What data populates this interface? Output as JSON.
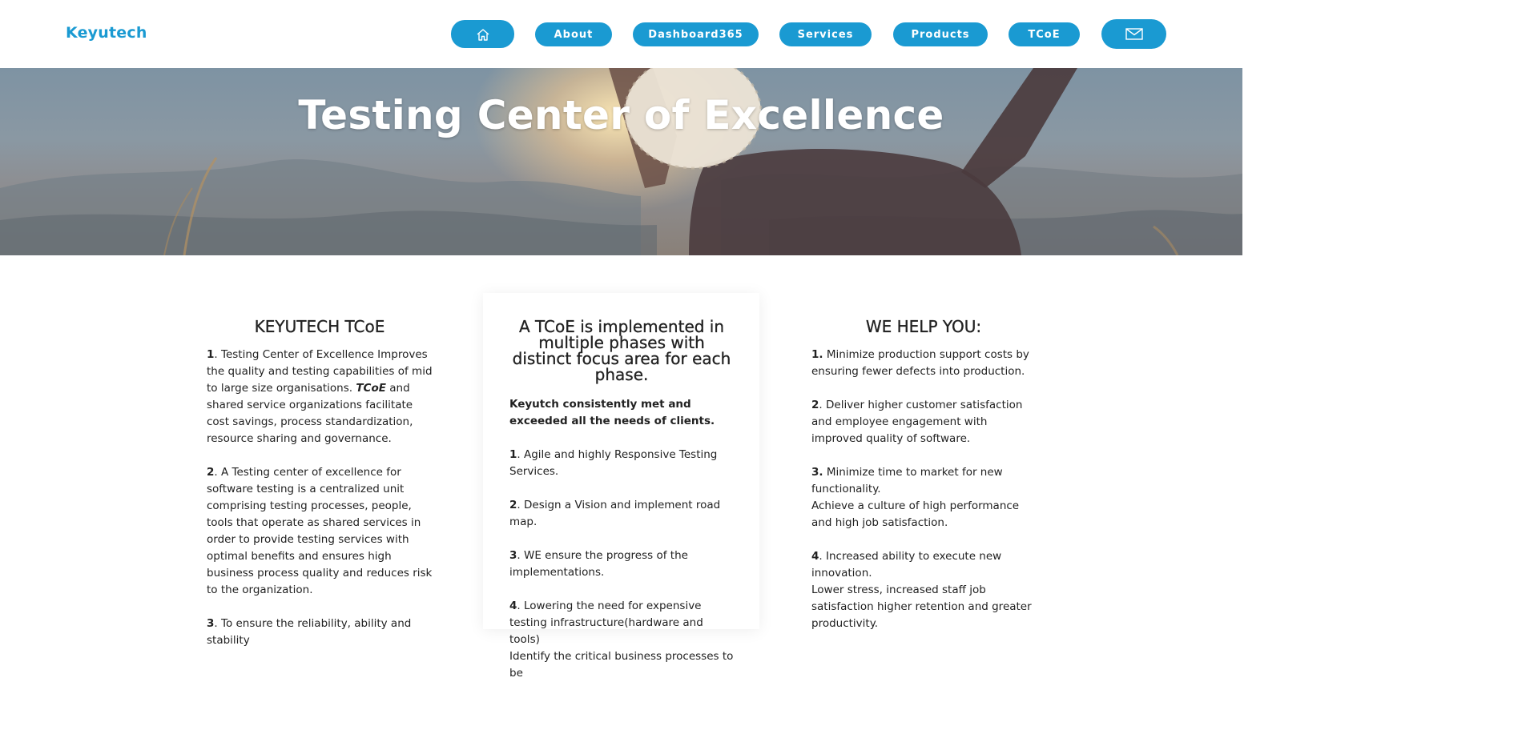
{
  "brand": "Keyutech",
  "nav": {
    "home_icon": "home-icon",
    "about": "About",
    "dashboard": "Dashboard365",
    "services": "Services",
    "products": "Products",
    "tcoe": "TCoE",
    "mail_icon": "mail-icon",
    "button_color": "#1a9ad2"
  },
  "hero": {
    "title": "Testing Center of Excellence"
  },
  "left": {
    "heading": "KEYUTECH TCoE",
    "items": [
      {
        "num": "1",
        "text_a": ". Testing Center of Excellence Improves the quality and testing capabilities of mid to large size organisations. ",
        "em": "TCoE",
        "text_b": " and shared service organizations facilitate cost savings, process standardization, resource sharing and governance."
      },
      {
        "num": "2",
        "text": ". A Testing center of excellence for software testing is a centralized unit comprising testing processes, people, tools that operate as shared services in order to provide testing services with optimal benefits and ensures high business process quality and reduces risk to the organization."
      },
      {
        "num": "3",
        "text": ". To ensure the reliability, ability and stability"
      }
    ]
  },
  "middle": {
    "heading": "A TCoE is implemented in multiple phases with distinct focus area for each phase.",
    "subhead": "Keyutch consistently met and exceeded all the needs of clients.",
    "items": [
      {
        "num": "1",
        "text": ". Agile and highly Responsive Testing Services."
      },
      {
        "num": "2",
        "text": ". Design a Vision and implement road map."
      },
      {
        "num": "3",
        "text": ". WE ensure the progress of the implementations."
      },
      {
        "num": "4",
        "text": ". Lowering the need for expensive testing infrastructure(hardware and tools)",
        "text2": "Identify the critical business processes to be"
      }
    ]
  },
  "right": {
    "heading": "WE HELP YOU:",
    "items": [
      {
        "num": "1.",
        "text": " Minimize production support costs by ensuring fewer defects into production."
      },
      {
        "num": "2",
        "text": ". Deliver higher customer satisfaction and employee engagement with improved quality of software."
      },
      {
        "num": "3.",
        "text": " Minimize time to market for new functionality.",
        "text2": "Achieve a culture of high performance and high job satisfaction."
      },
      {
        "num": "4",
        "text": ". Increased ability to execute new innovation.",
        "text2": "Lower stress, increased staff job satisfaction higher retention and greater productivity."
      }
    ]
  }
}
